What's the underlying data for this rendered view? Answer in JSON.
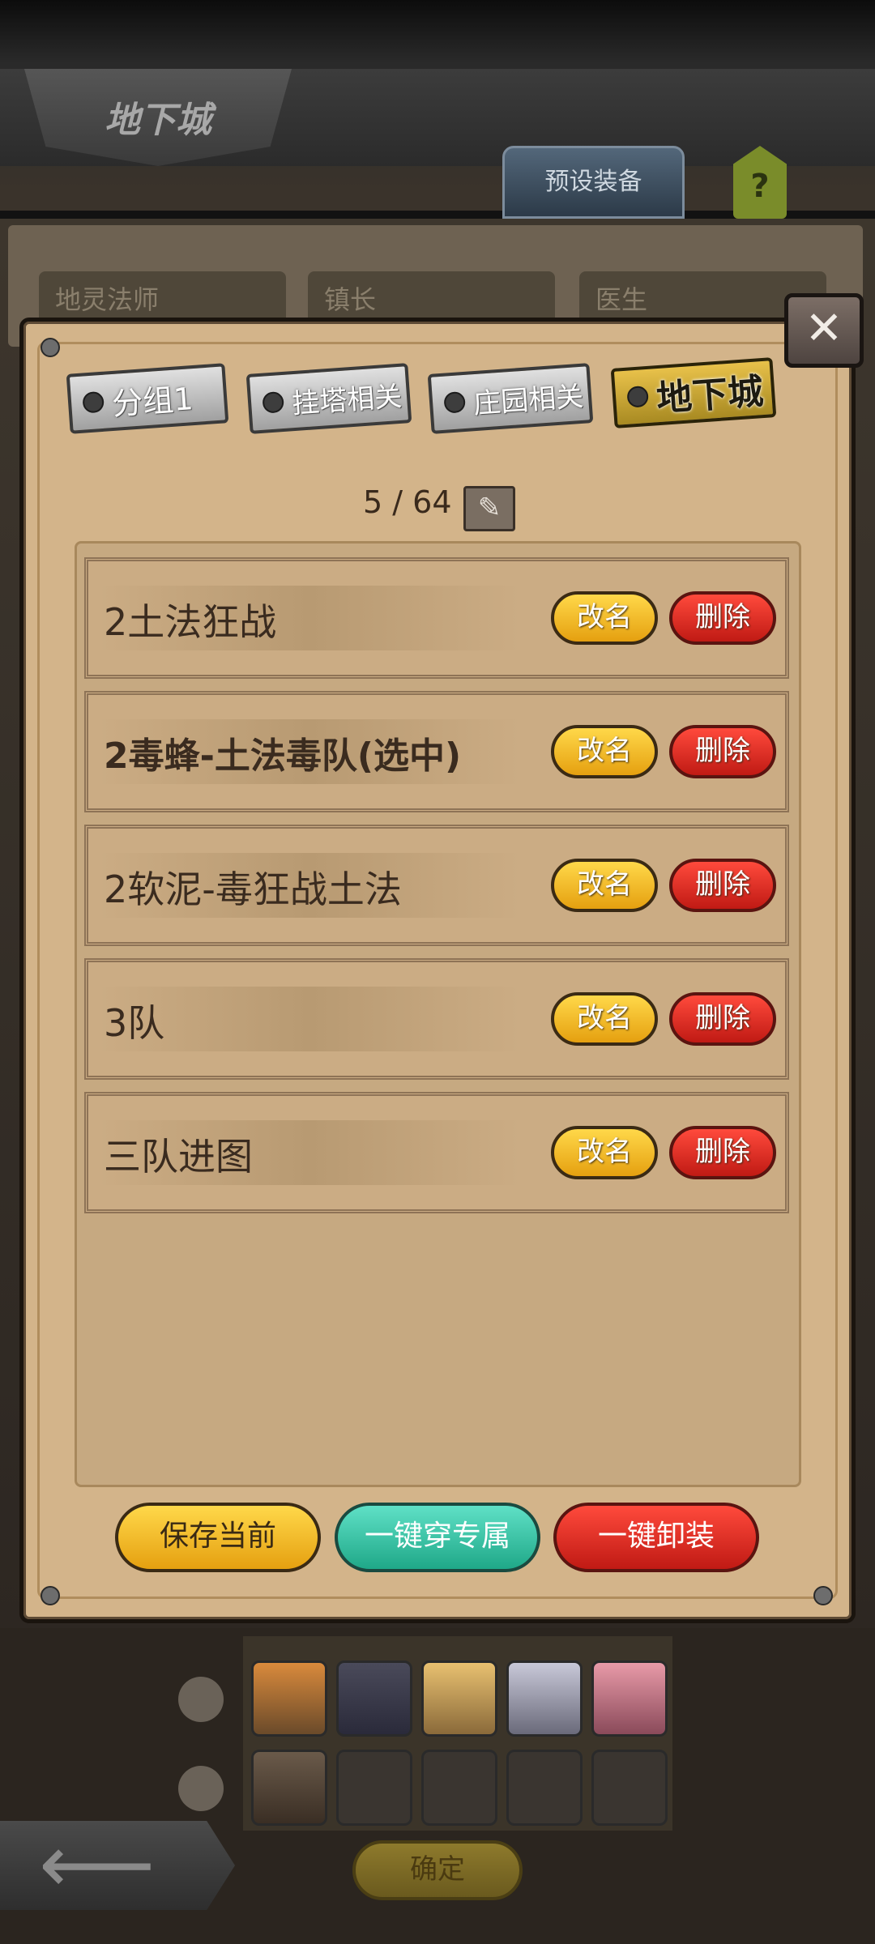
{
  "background": {
    "screen_title": "地下城",
    "preset_button": "预设装备",
    "help_label": "?",
    "fields": [
      "地灵法师",
      "镇长",
      "医生"
    ],
    "back_label": "⟵",
    "confirm_button": "确定"
  },
  "dialog": {
    "close_label": "✕",
    "tabs": [
      {
        "label": "分组1",
        "active": false
      },
      {
        "label": "挂塔相关",
        "active": false
      },
      {
        "label": "庄园相关",
        "active": false
      },
      {
        "label": "地下城",
        "active": true
      }
    ],
    "counter": "5 / 64",
    "edit_icon": "✎",
    "rows": [
      {
        "name": "2土法狂战",
        "selected": false,
        "rename": "改名",
        "delete": "删除"
      },
      {
        "name": "2毒蜂-土法毒队(选中)",
        "selected": true,
        "rename": "改名",
        "delete": "删除"
      },
      {
        "name": "2软泥-毒狂战土法",
        "selected": false,
        "rename": "改名",
        "delete": "删除"
      },
      {
        "name": "3队",
        "selected": false,
        "rename": "改名",
        "delete": "删除"
      },
      {
        "name": "三队进图",
        "selected": false,
        "rename": "改名",
        "delete": "删除"
      }
    ],
    "buttons": {
      "save": "保存当前",
      "exclusive": "一键穿专属",
      "unequip": "一键卸装"
    }
  },
  "colors": {
    "panel": "#d3b48a",
    "gold_button": "#e5a010",
    "red_button": "#c01a14",
    "teal_button": "#1fa888"
  }
}
